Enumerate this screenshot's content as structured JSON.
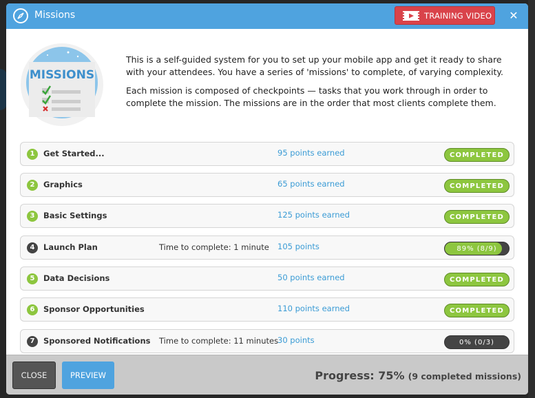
{
  "header": {
    "title": "Missions",
    "training_video_label": "TRAINING VIDEO",
    "close_symbol": "✕"
  },
  "intro": {
    "graphic_label": "MISSIONS",
    "paragraphs": [
      "This is a self-guided system for you to set up your mobile app and get it ready to share with your attendees. You have a series of 'missions' to complete, of varying complexity.",
      "Each mission is composed of checkpoints — tasks that you work through in order to complete the mission. The missions are in the order that most clients complete them."
    ]
  },
  "missions": [
    {
      "number": "1",
      "name": "Get Started...",
      "time": "",
      "points": "95 points earned",
      "status": "COMPLETED",
      "state": "complete"
    },
    {
      "number": "2",
      "name": "Graphics",
      "time": "",
      "points": "65 points earned",
      "status": "COMPLETED",
      "state": "complete"
    },
    {
      "number": "3",
      "name": "Basic Settings",
      "time": "",
      "points": "125 points earned",
      "status": "COMPLETED",
      "state": "complete"
    },
    {
      "number": "4",
      "name": "Launch Plan",
      "time": "Time to complete: 1 minute",
      "points": "105 points",
      "status": "89% (8/9)",
      "state": "progress",
      "progress": 0.89
    },
    {
      "number": "5",
      "name": "Data Decisions",
      "time": "",
      "points": "50 points earned",
      "status": "COMPLETED",
      "state": "complete"
    },
    {
      "number": "6",
      "name": "Sponsor Opportunities",
      "time": "",
      "points": "110 points earned",
      "status": "COMPLETED",
      "state": "complete"
    },
    {
      "number": "7",
      "name": "Sponsored Notifications",
      "time": "Time to complete: 11 minutes",
      "points": "30 points",
      "status": "0% (0/3)",
      "state": "progress",
      "progress": 0
    }
  ],
  "footer": {
    "close_label": "CLOSE",
    "preview_label": "PREVIEW",
    "progress_label": "Progress: 75%",
    "progress_detail": "(9 completed missions)"
  },
  "colors": {
    "header_blue": "#4FA3DF",
    "training_red": "#D9434A",
    "complete_green": "#8DC63F",
    "pending_dark": "#444444",
    "points_blue": "#3a9bd5"
  }
}
